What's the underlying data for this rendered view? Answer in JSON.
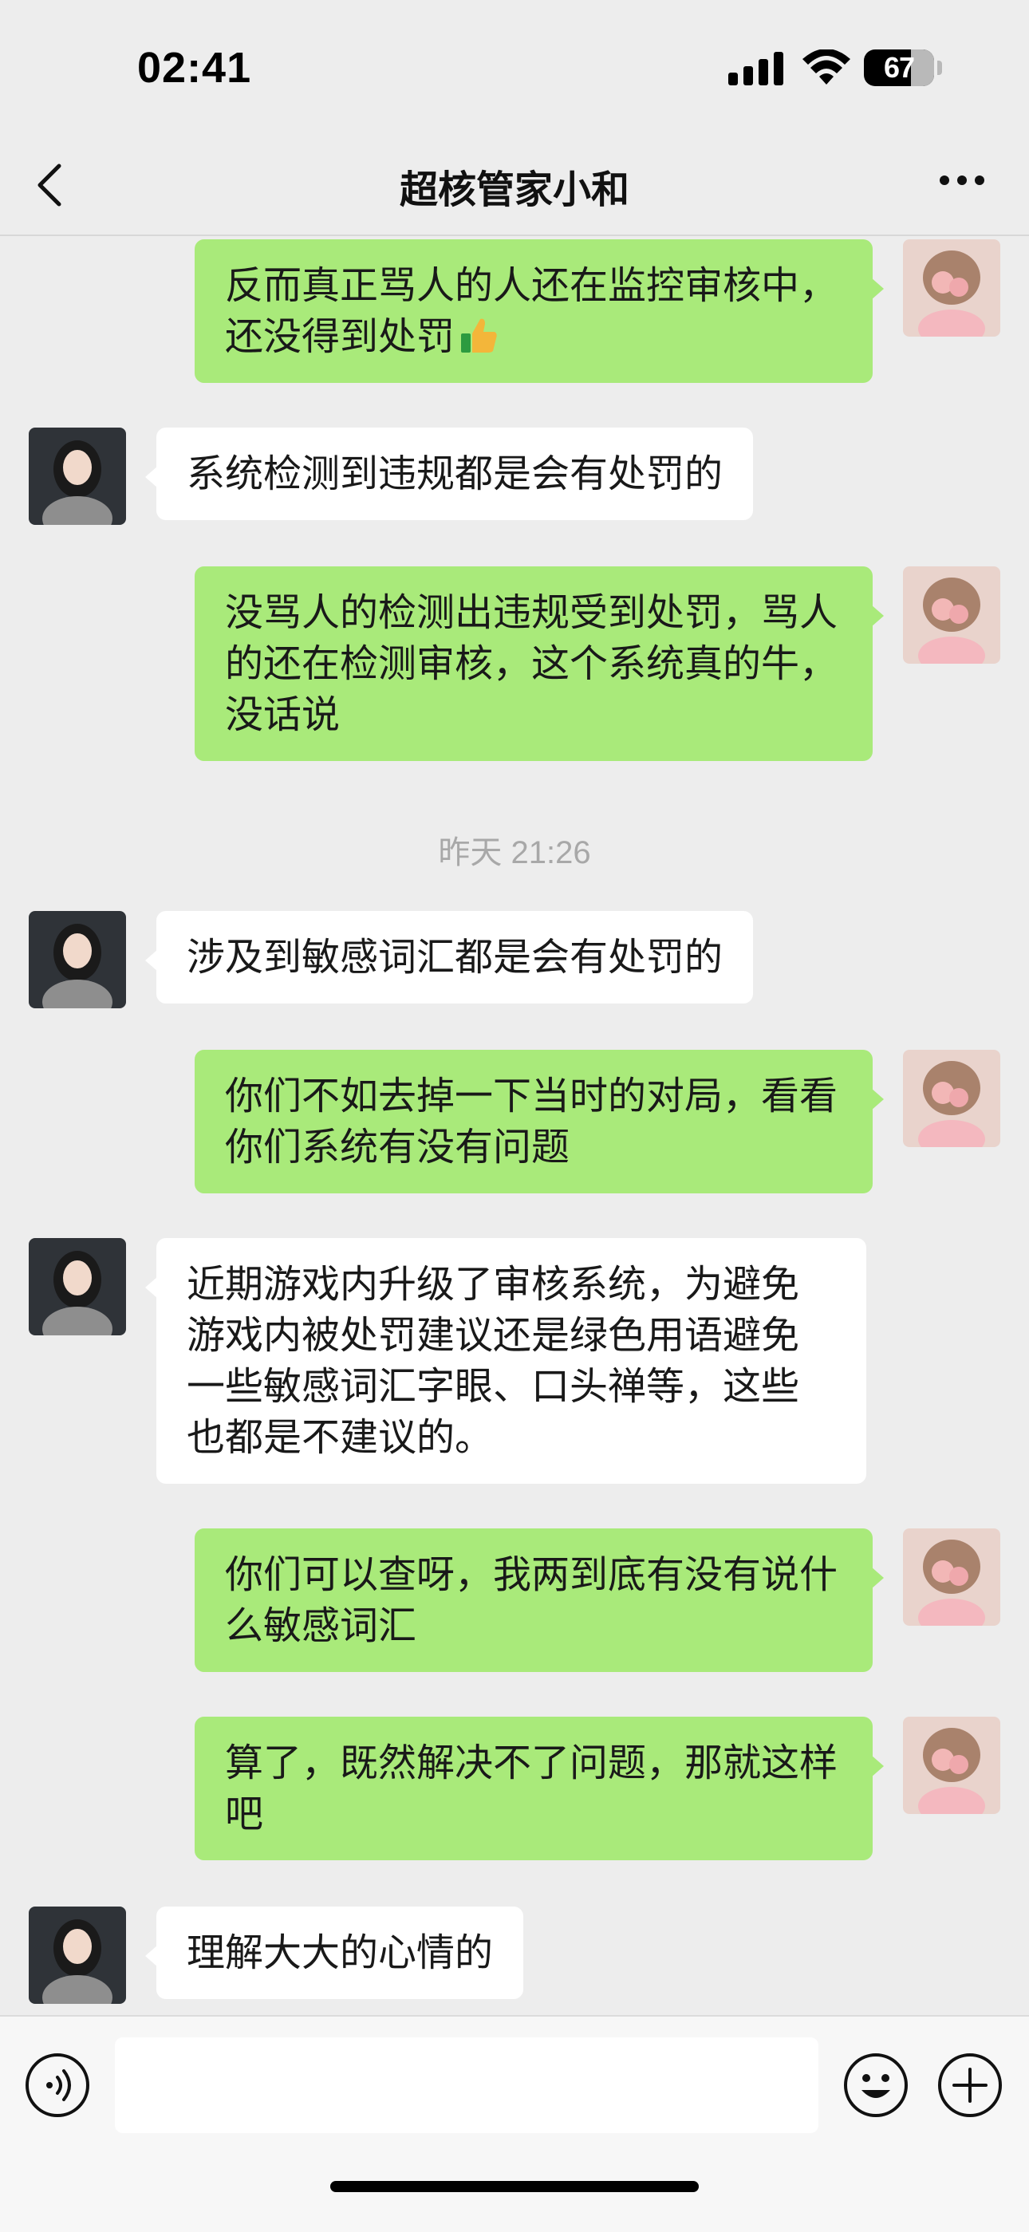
{
  "status_bar": {
    "time": "02:41",
    "battery": "67",
    "battery_level_percent": 67
  },
  "header": {
    "title": "超核管家小和"
  },
  "messages": [
    {
      "side": "mine",
      "text": "反而真正骂人的人还在监控审核中，还没得到处罚",
      "emoji": "thumbs-up-icon"
    },
    {
      "side": "other",
      "text": "系统检测到违规都是会有处罚的"
    },
    {
      "side": "mine",
      "text": "没骂人的检测出违规受到处罚，骂人的还在检测审核，这个系统真的牛，没话说"
    },
    {
      "time_divider": "昨天 21:26"
    },
    {
      "side": "other",
      "text": "涉及到敏感词汇都是会有处罚的"
    },
    {
      "side": "mine",
      "text": "你们不如去掉一下当时的对局，看看你们系统有没有问题"
    },
    {
      "side": "other",
      "text": "近期游戏内升级了审核系统，为避免游戏内被处罚建议还是绿色用语避免一些敏感词汇字眼、口头禅等，这些也都是不建议的。"
    },
    {
      "side": "mine",
      "text": "你们可以查呀，我两到底有没有说什么敏感词汇"
    },
    {
      "side": "mine",
      "text": "算了，既然解决不了问题，那就这样吧"
    },
    {
      "side": "other",
      "text": "理解大大的心情的"
    }
  ],
  "input_bar": {
    "placeholder": ""
  },
  "colors": {
    "mine_bubble": "#a9ea7a",
    "other_bubble": "#ffffff",
    "background": "#ededed"
  }
}
